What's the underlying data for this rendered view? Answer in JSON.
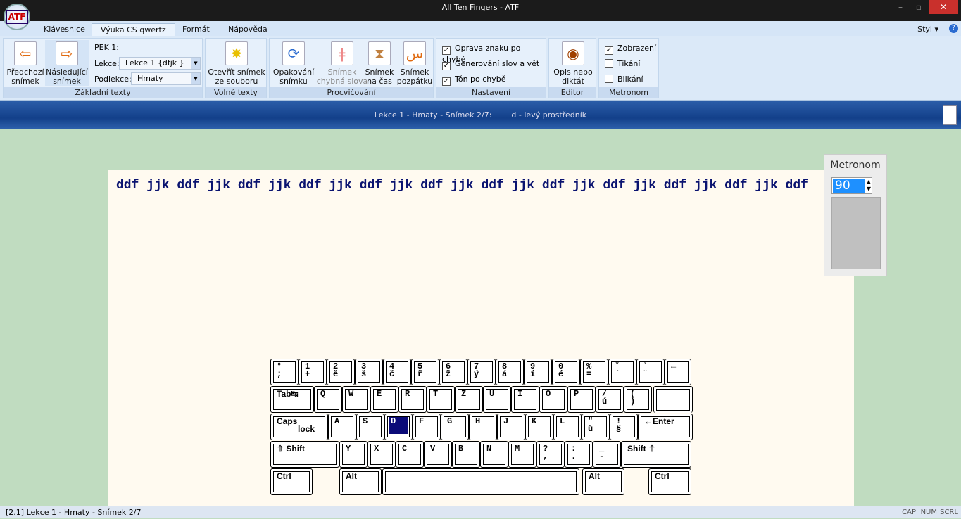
{
  "window": {
    "title": "All Ten Fingers - ATF",
    "logo": "ATF"
  },
  "tabs": [
    "Klávesnice",
    "Výuka CS qwertz",
    "Formát",
    "Nápověda"
  ],
  "style_menu": "Styl",
  "ribbon": {
    "zakladni": {
      "label": "Základní texty",
      "prev": [
        "Předchozí",
        "snímek"
      ],
      "next": [
        "Následující",
        "snímek"
      ],
      "pek": "PEK 1:",
      "lekce_label": "Lekce:",
      "lekce_value": "Lekce   1 {dfjk }",
      "podlekce_label": "Podlekce:",
      "podlekce_value": "Hmaty"
    },
    "volne": {
      "label": "Volné texty",
      "open": [
        "Otevřít snímek",
        "ze souboru"
      ]
    },
    "procvicovani": {
      "label": "Procvičování",
      "buttons": [
        [
          "Opakování",
          "snímku"
        ],
        [
          "Snímek",
          "chybná slova"
        ],
        [
          "Snímek",
          "na čas"
        ],
        [
          "Snímek",
          "pozpátku"
        ]
      ]
    },
    "nastaveni": {
      "label": "Nastavení",
      "checks": [
        {
          "label": "Oprava znaku po chybě",
          "checked": true
        },
        {
          "label": "Generování slov a vět",
          "checked": true
        },
        {
          "label": "Tón po chybě",
          "checked": true
        }
      ]
    },
    "editor": {
      "label": "Editor",
      "button": [
        "Opis nebo",
        "diktát"
      ]
    },
    "metronom": {
      "label": "Metronom",
      "checks": [
        {
          "label": "Zobrazení",
          "checked": true
        },
        {
          "label": "Tikání",
          "checked": false
        },
        {
          "label": "Blikání",
          "checked": false
        }
      ]
    }
  },
  "banner": {
    "lesson": "Lekce 1 - Hmaty - Snímek 2/7:",
    "hint": "d - levý prostředník"
  },
  "exercise_text": "ddf jjk ddf jjk ddf jjk ddf jjk ddf jjk ddf jjk ddf jjk ddf jjk ddf jjk ddf jjk ddf jjk ddf",
  "metronome_panel": {
    "title": "Metronom",
    "value": "90"
  },
  "keyboard": {
    "highlight": "D",
    "rows": [
      [
        [
          "°",
          ";"
        ],
        [
          "1",
          "+"
        ],
        [
          "2",
          "ě"
        ],
        [
          "3",
          "š"
        ],
        [
          "4",
          "č"
        ],
        [
          "5",
          "ř"
        ],
        [
          "6",
          "ž"
        ],
        [
          "7",
          "ý"
        ],
        [
          "8",
          "á"
        ],
        [
          "9",
          "í"
        ],
        [
          "0",
          "é"
        ],
        [
          "%",
          "="
        ],
        [
          "ˇ",
          "´"
        ],
        [
          "`",
          "¨"
        ],
        [
          "←",
          ""
        ]
      ],
      [
        [
          "Tab↹",
          ""
        ],
        [
          "Q",
          ""
        ],
        [
          "W",
          ""
        ],
        [
          "E",
          ""
        ],
        [
          "R",
          ""
        ],
        [
          "T",
          ""
        ],
        [
          "Z",
          ""
        ],
        [
          "U",
          ""
        ],
        [
          "I",
          ""
        ],
        [
          "O",
          ""
        ],
        [
          "P",
          ""
        ],
        [
          "/",
          "ú"
        ],
        [
          "(",
          ")"
        ]
      ],
      [
        [
          "Caps",
          "lock"
        ],
        [
          "A",
          ""
        ],
        [
          "S",
          ""
        ],
        [
          "D",
          ""
        ],
        [
          "F",
          ""
        ],
        [
          "G",
          ""
        ],
        [
          "H",
          ""
        ],
        [
          "J",
          ""
        ],
        [
          "K",
          ""
        ],
        [
          "L",
          ""
        ],
        [
          "\"",
          "ů"
        ],
        [
          "!",
          "§"
        ],
        [
          "←Enter",
          ""
        ]
      ],
      [
        [
          "⇧  Shift",
          ""
        ],
        [
          "Y",
          ""
        ],
        [
          "X",
          ""
        ],
        [
          "C",
          ""
        ],
        [
          "V",
          ""
        ],
        [
          "B",
          ""
        ],
        [
          "N",
          ""
        ],
        [
          "M",
          ""
        ],
        [
          "?",
          ","
        ],
        [
          ":",
          "."
        ],
        [
          "_",
          "-"
        ],
        [
          "Shift  ⇧",
          ""
        ]
      ],
      [
        [
          "Ctrl",
          ""
        ],
        [
          "Alt",
          ""
        ],
        [
          "",
          ""
        ],
        [
          "Alt",
          ""
        ],
        [
          "Ctrl",
          ""
        ]
      ]
    ]
  },
  "status": {
    "left": "[2.1]  Lekce 1 - Hmaty - Snímek 2/7",
    "cap": "CAP",
    "num": "NUM",
    "scrl": "SCRL"
  }
}
